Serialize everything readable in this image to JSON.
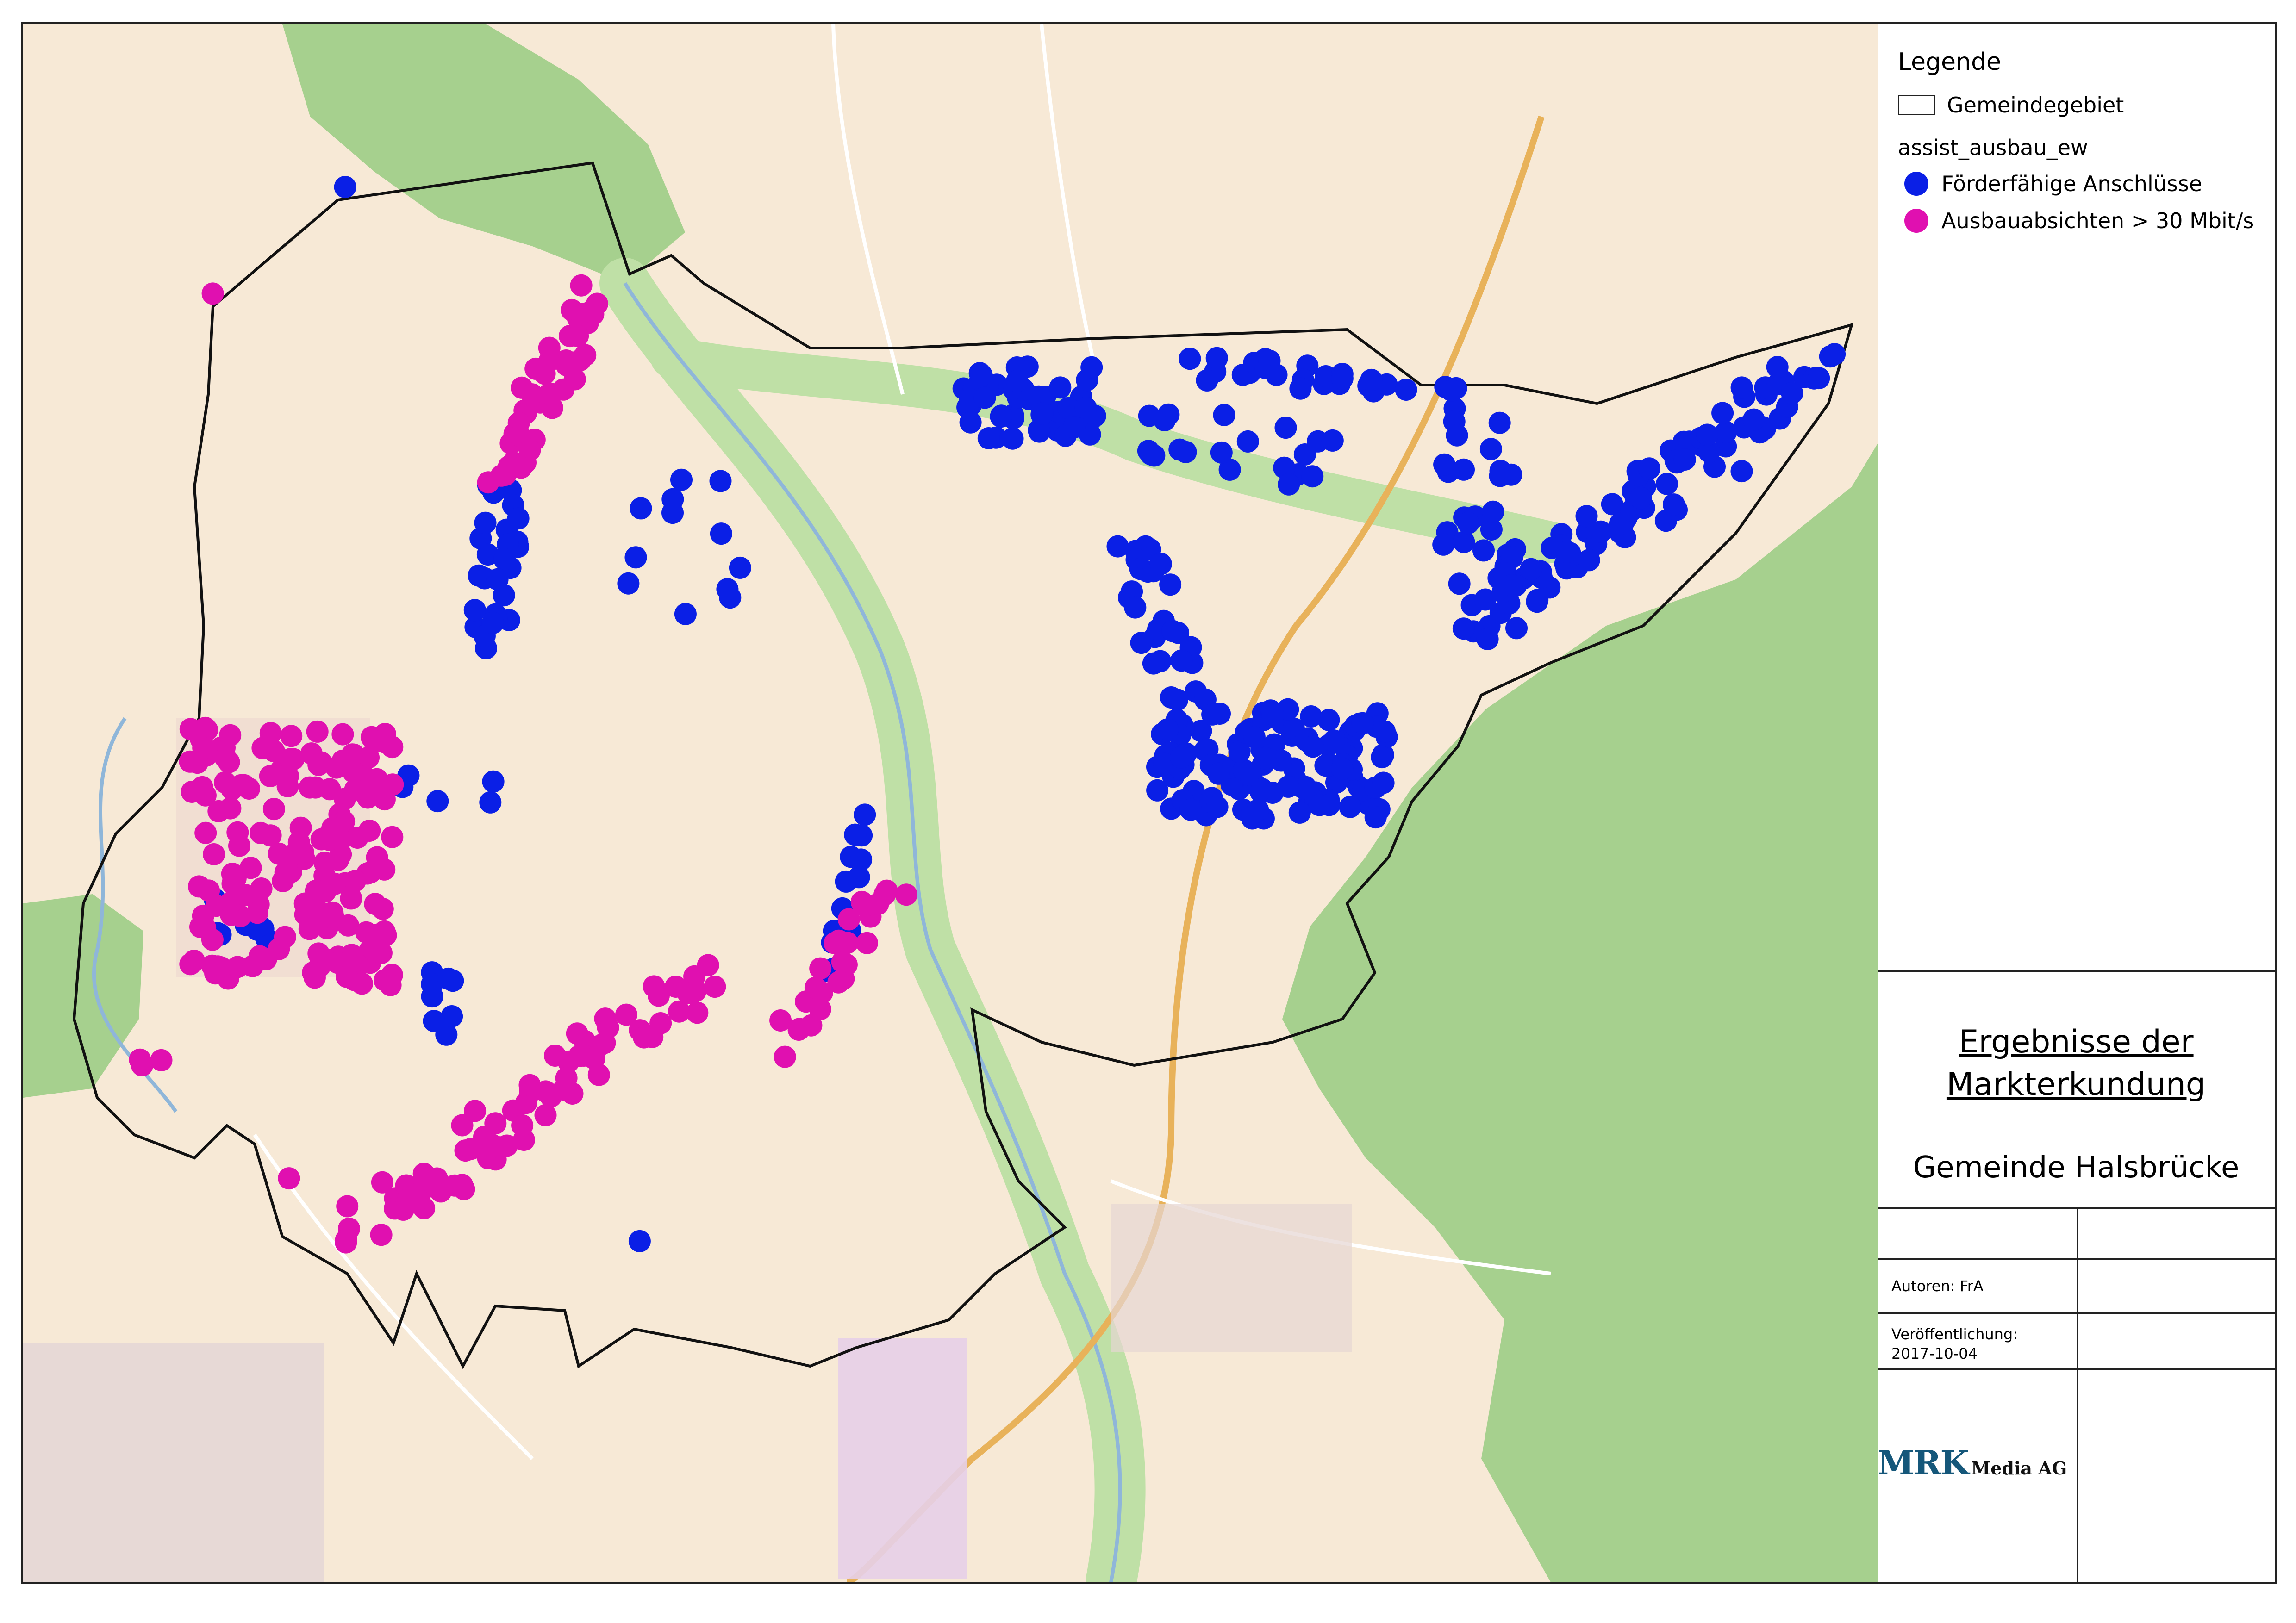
{
  "legend": {
    "title": "Legende",
    "boundary_label": "Gemeindegebiet",
    "layer_name": "assist_ausbau_ew",
    "items": [
      {
        "label": "Förderfähige Anschlüsse",
        "color": "#0a1fe6"
      },
      {
        "label": "Ausbauabsichten > 30 Mbit/s",
        "color": "#e010b0"
      }
    ]
  },
  "title_block": {
    "title_line1": "Ergebnisse der",
    "title_line2": "Markterkundung",
    "subtitle": "Gemeinde Halsbrücke",
    "authors": "Autoren: FrA",
    "published_label": "Veröffentlichung:",
    "published_date": "2017-10-04",
    "logo_mark": "MRK",
    "logo_text": "Media AG"
  },
  "colors": {
    "eligible": "#0a1fe6",
    "expansion": "#e010b0",
    "forest": "#9fcc86",
    "farmland": "#f7e9d6",
    "boundary": "#111111"
  }
}
